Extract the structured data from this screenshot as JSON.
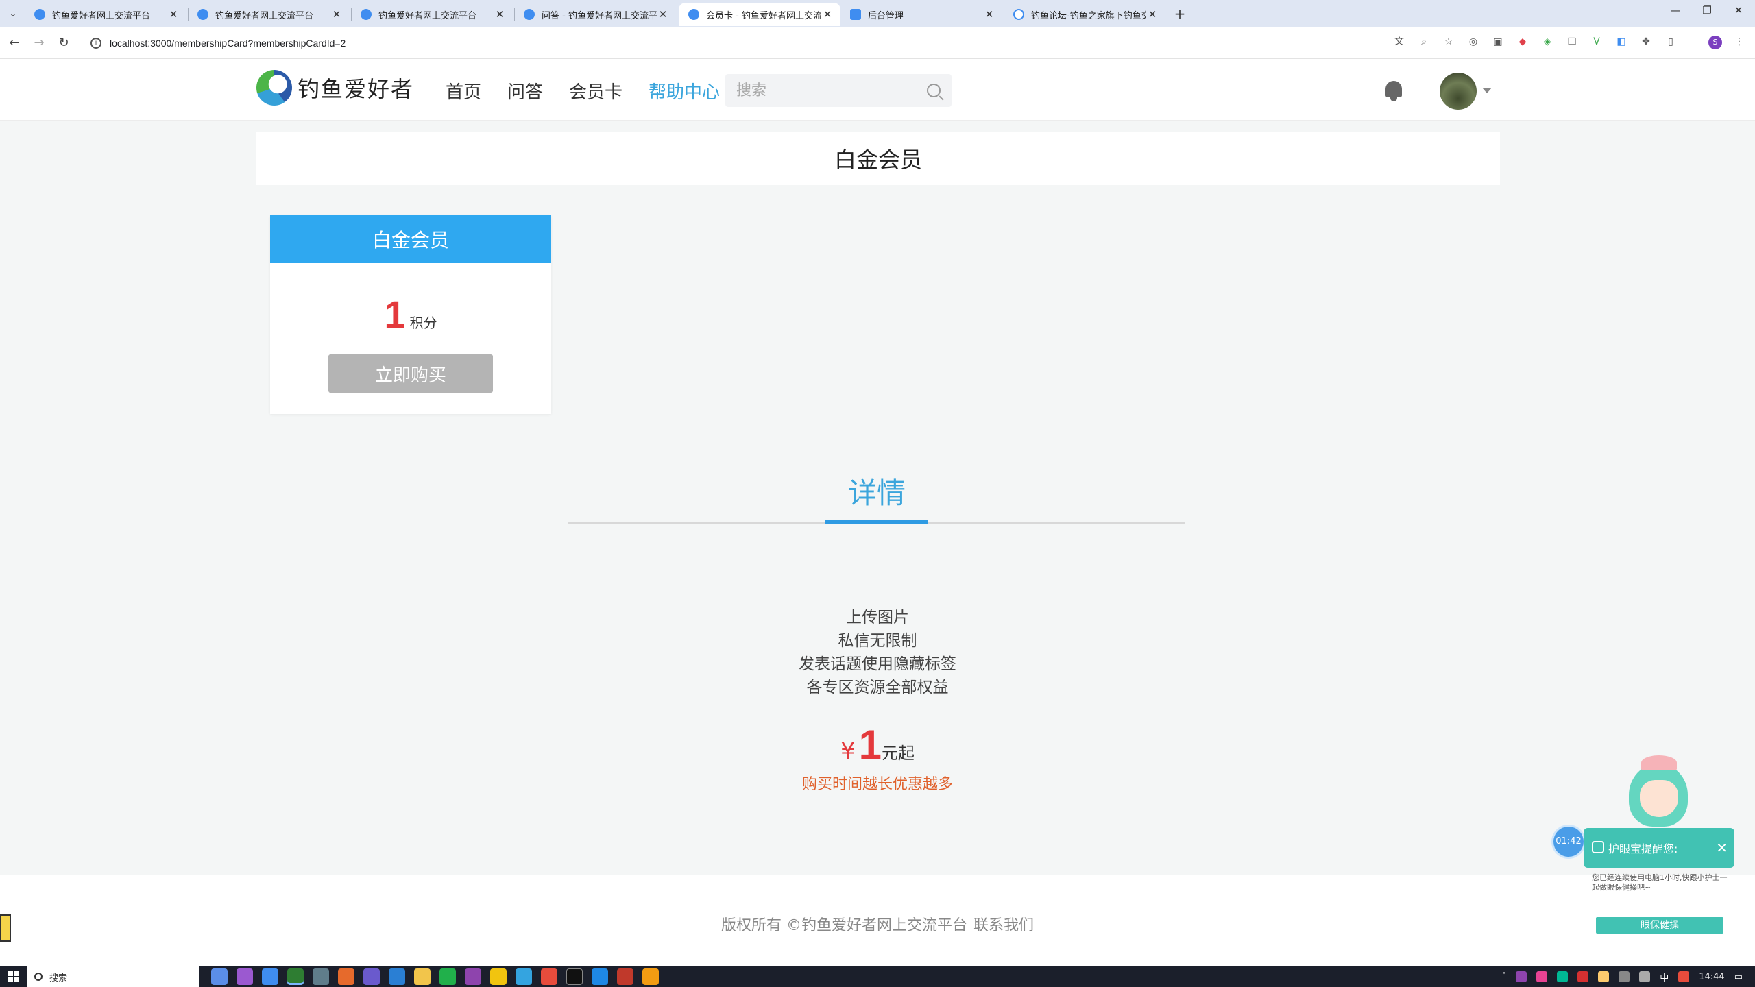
{
  "browser": {
    "tabs": [
      {
        "title": "钓鱼爱好者网上交流平台",
        "favicon": "site-icon",
        "active": false
      },
      {
        "title": "钓鱼爱好者网上交流平台",
        "favicon": "site-icon",
        "active": false
      },
      {
        "title": "钓鱼爱好者网上交流平台",
        "favicon": "site-icon",
        "active": false
      },
      {
        "title": "问答 - 钓鱼爱好者网上交流平台",
        "favicon": "site-icon",
        "active": false
      },
      {
        "title": "会员卡 - 钓鱼爱好者网上交流平",
        "favicon": "site-icon",
        "active": true
      },
      {
        "title": "后台管理",
        "favicon": "admin-icon",
        "active": false
      },
      {
        "title": "钓鱼论坛-钓鱼之家旗下钓鱼交",
        "favicon": "globe-icon",
        "active": false
      }
    ],
    "url": "localhost:3000/membershipCard?membershipCardId=2",
    "profile_initial": "S"
  },
  "site": {
    "logo_text": "钓鱼爱好者",
    "nav": [
      "首页",
      "问答",
      "会员卡",
      "帮助中心"
    ],
    "active_nav": "帮助中心",
    "search_placeholder": "搜索"
  },
  "page": {
    "title": "白金会员"
  },
  "card": {
    "name": "白金会员",
    "price": "1",
    "price_unit": "积分",
    "buy_label": "立即购买"
  },
  "details": {
    "tab_label": "详情",
    "benefits": [
      "上传图片",
      "私信无限制",
      "发表话题使用隐藏标签",
      "各专区资源全部权益"
    ],
    "currency": "¥",
    "price": "1",
    "price_suffix": "元起",
    "promo": "购买时间越长优惠越多"
  },
  "footer": {
    "copyright": "版权所有 ©钓鱼爱好者网上交流平台",
    "contact": "联系我们"
  },
  "eye_care": {
    "timer": "01:42",
    "title": "护眼宝提醒您:",
    "message": "您已经连续使用电脑1小时,快跟小护士一起做眼保健操吧~",
    "button": "眼保健操"
  },
  "taskbar": {
    "search_label": "搜索",
    "ime": "中",
    "clock": "14:44"
  },
  "colors": {
    "accent": "#3ba5dc",
    "card_header": "#2fa8f0",
    "price_red": "#e4393c",
    "promo_orange": "#e0612c",
    "eye_care_teal": "#41c2b3"
  }
}
